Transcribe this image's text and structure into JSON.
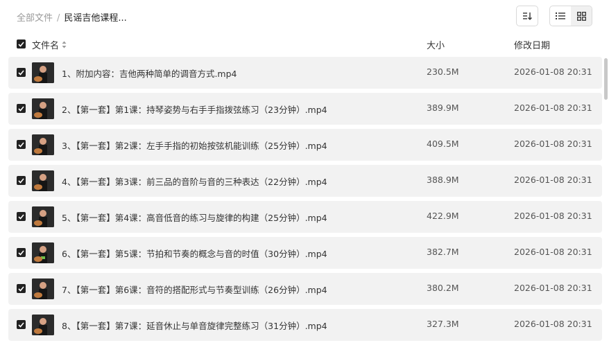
{
  "breadcrumb": {
    "root": "全部文件",
    "separator": "/",
    "current": "民谣吉他课程..."
  },
  "toolbar": {
    "sort_icon": "sort-icon",
    "list_view_icon": "list-view-icon",
    "grid_view_icon": "grid-view-icon"
  },
  "header": {
    "name": "文件名",
    "size": "大小",
    "modified": "修改日期"
  },
  "files": [
    {
      "name": "1、附加内容：吉他两种简单的调音方式.mp4",
      "size": "230.5M",
      "date": "2026-01-08 20:31"
    },
    {
      "name": "2、【第一套】第1课：持琴姿势与右手手指拨弦练习（23分钟）.mp4",
      "size": "389.9M",
      "date": "2026-01-08 20:31"
    },
    {
      "name": "3、【第一套】第2课：左手手指的初始按弦机能训练（25分钟）.mp4",
      "size": "409.5M",
      "date": "2026-01-08 20:31"
    },
    {
      "name": "4、【第一套】第3课：前三品的音阶与音的三种表达（22分钟）.mp4",
      "size": "388.9M",
      "date": "2026-01-08 20:31"
    },
    {
      "name": "5、【第一套】第4课：高音低音的练习与旋律的构建（25分钟）.mp4",
      "size": "422.9M",
      "date": "2026-01-08 20:31"
    },
    {
      "name": "6、【第一套】第5课：节拍和节奏的概念与音的时值（30分钟）.mp4",
      "size": "382.7M",
      "date": "2026-01-08 20:31"
    },
    {
      "name": "7、【第一套】第6课：音符的搭配形式与节奏型训练（26分钟）.mp4",
      "size": "380.2M",
      "date": "2026-01-08 20:31"
    },
    {
      "name": "8、【第一套】第7课：延音休止与单音旋律完整练习（31分钟）.mp4",
      "size": "327.3M",
      "date": "2026-01-08 20:31"
    }
  ]
}
